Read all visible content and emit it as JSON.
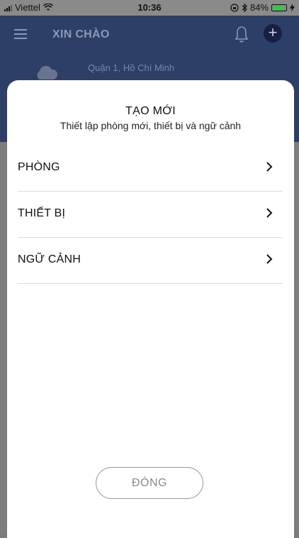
{
  "status_bar": {
    "carrier": "Viettel",
    "time": "10:36",
    "battery": "84%",
    "battery_level": 0.84
  },
  "app_header": {
    "greeting": "XIN CHÀO",
    "location": "Quận 1, Hồ Chí Minh",
    "add_symbol": "+"
  },
  "modal": {
    "title": "TẠO MỚI",
    "subtitle": "Thiết lập phòng mới, thiết bị và ngữ cảnh",
    "items": [
      {
        "label": "PHÒNG"
      },
      {
        "label": "THIẾT BỊ"
      },
      {
        "label": "NGỮ CẢNH"
      }
    ],
    "close_label": "ĐÓNG"
  },
  "colors": {
    "header_bg": "#2d3f66",
    "overlay": "#7b7b7b",
    "sheet_bg": "#ffffff",
    "accent_button": "#162043"
  },
  "icons": [
    "wifi-icon",
    "signal-icon",
    "bluetooth-icon",
    "lock-rotation-icon",
    "battery-icon",
    "charging-icon",
    "menu-icon",
    "bell-icon",
    "plus-icon",
    "cloud-icon",
    "chevron-right-icon"
  ]
}
